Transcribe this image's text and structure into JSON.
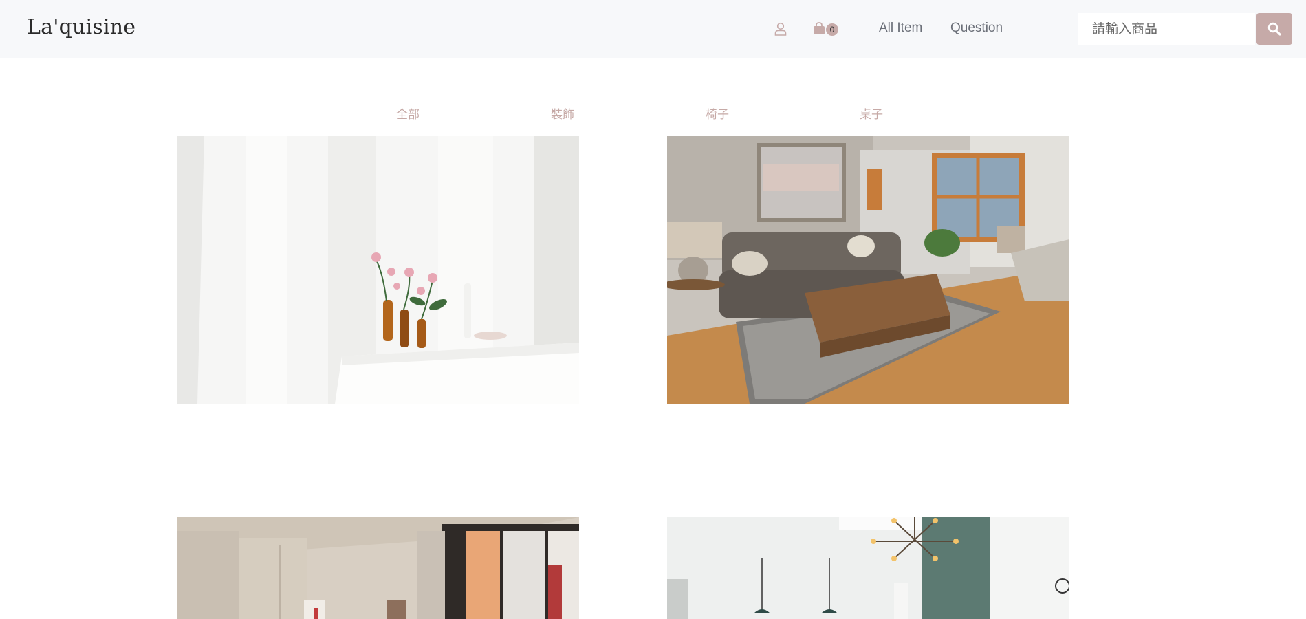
{
  "brand": "La'quisine",
  "cart": {
    "count": "0"
  },
  "nav": {
    "all_items": "All Item",
    "question": "Question"
  },
  "search": {
    "placeholder": "請輸入商品"
  },
  "categories": [
    "全部",
    "裝飾",
    "椅子",
    "桌子"
  ],
  "colors": {
    "accent": "#c6aaa8",
    "navbar_bg": "#f7f8fa",
    "category_text": "#c6a9a6"
  },
  "icons": {
    "user": "user-icon",
    "cart": "shopping-bag-icon",
    "search": "search-icon"
  },
  "products": [
    {
      "image": "white table with pink roses in amber bottles by sheer curtains"
    },
    {
      "image": "living room with grey sofa, wooden coffee table and window"
    },
    {
      "image": "bright room with beige wardrobe and tall window"
    },
    {
      "image": "kitchen dining area with teal wall and modern chandelier"
    }
  ]
}
